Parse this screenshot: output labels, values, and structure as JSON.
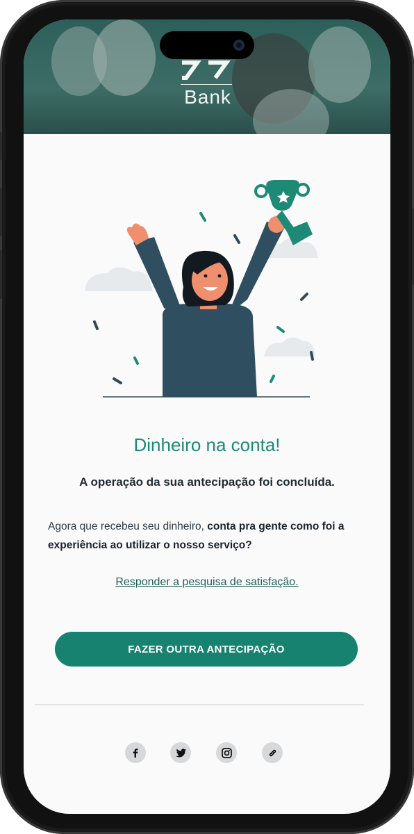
{
  "app": {
    "brand": "Bank"
  },
  "colors": {
    "accent": "#16826f",
    "title": "#1e8a76",
    "header": "#2d5f5a"
  },
  "content": {
    "title": "Dinheiro na conta!",
    "subtitle": "A operação da sua antecipação foi concluída.",
    "body_plain": "Agora que recebeu seu dinheiro,",
    "body_bold": "conta pra gente como foi a experiência ao utilizar o nosso serviço?",
    "survey_link": "Responder a pesquisa de satisfação.",
    "cta_label": "FAZER OUTRA ANTECIPAÇÃO"
  },
  "social": [
    {
      "name": "facebook",
      "icon": "facebook-icon"
    },
    {
      "name": "twitter",
      "icon": "twitter-icon"
    },
    {
      "name": "instagram",
      "icon": "instagram-icon"
    },
    {
      "name": "link",
      "icon": "link-icon"
    }
  ]
}
